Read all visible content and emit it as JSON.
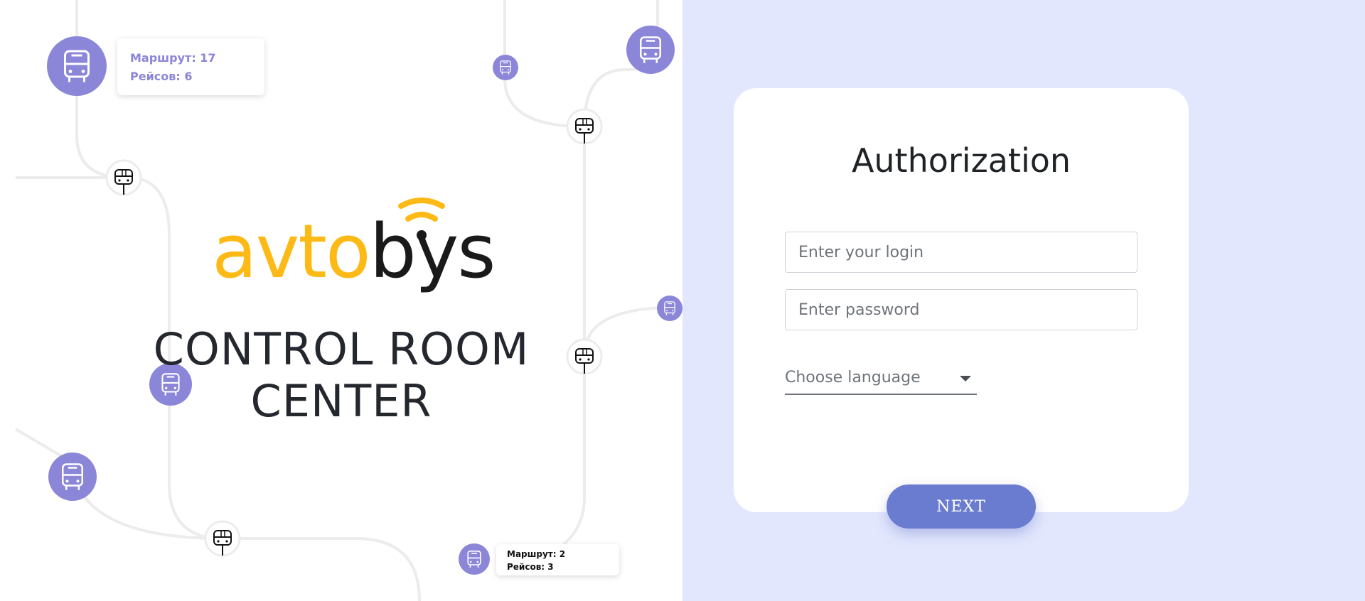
{
  "brand": {
    "logo_part1": "avto",
    "logo_part2": "bys",
    "accent_color": "#fdba16",
    "dark_color": "#1a1a1a"
  },
  "hero": {
    "line1": "CONTROL ROOM",
    "line2": "CENTER"
  },
  "map": {
    "route_card_1": {
      "route": "Маршрут: 17",
      "trips": "Рейсов: 6"
    },
    "route_card_2": {
      "route": "Маршрут: 2",
      "trips": "Рейсов: 3"
    },
    "icons": [
      "bus-icon",
      "bus-stop-icon"
    ],
    "bus_color": "#8b86d8",
    "road_color": "#ececec"
  },
  "auth": {
    "title": "Authorization",
    "login_placeholder": "Enter your login",
    "password_placeholder": "Enter password",
    "language_label": "Choose language",
    "next_label": "NEXT",
    "button_color": "#6a7ccf",
    "background_color": "#e3e7fd"
  }
}
